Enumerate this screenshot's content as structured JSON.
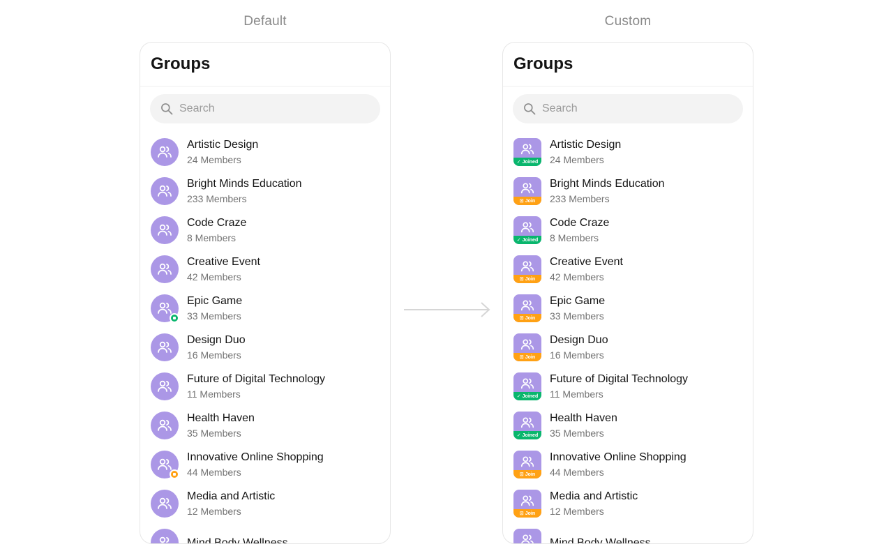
{
  "labels": {
    "default": "Default",
    "custom": "Custom"
  },
  "panel": {
    "title": "Groups",
    "search_placeholder": "Search"
  },
  "colors": {
    "avatar": "#ab97e6",
    "joined": "#09b66d",
    "join": "#ffa114",
    "online_dot": "#09b66d",
    "pending_dot": "#ffa114"
  },
  "icons": {
    "avatar": "group-icon",
    "search": "search-icon",
    "arrow": "arrow-right-icon"
  },
  "groups": [
    {
      "name": "Artistic Design",
      "members": "24 Members",
      "badge": "Joined",
      "dot": ""
    },
    {
      "name": "Bright Minds Education",
      "members": "233 Members",
      "badge": "Join",
      "dot": ""
    },
    {
      "name": "Code Craze",
      "members": "8 Members",
      "badge": "Joined",
      "dot": ""
    },
    {
      "name": "Creative Event",
      "members": "42 Members",
      "badge": "Join",
      "dot": ""
    },
    {
      "name": "Epic Game",
      "members": "33 Members",
      "badge": "Join",
      "dot": "online"
    },
    {
      "name": "Design Duo",
      "members": "16 Members",
      "badge": "Join",
      "dot": ""
    },
    {
      "name": "Future of Digital Technology",
      "members": "11 Members",
      "badge": "Joined",
      "dot": ""
    },
    {
      "name": "Health Haven",
      "members": "35 Members",
      "badge": "Joined",
      "dot": ""
    },
    {
      "name": "Innovative Online Shopping",
      "members": "44 Members",
      "badge": "Join",
      "dot": "pending"
    },
    {
      "name": "Media and Artistic",
      "members": "12 Members",
      "badge": "Join",
      "dot": ""
    },
    {
      "name": "Mind Body Wellness",
      "members": "",
      "badge": "",
      "dot": ""
    }
  ]
}
